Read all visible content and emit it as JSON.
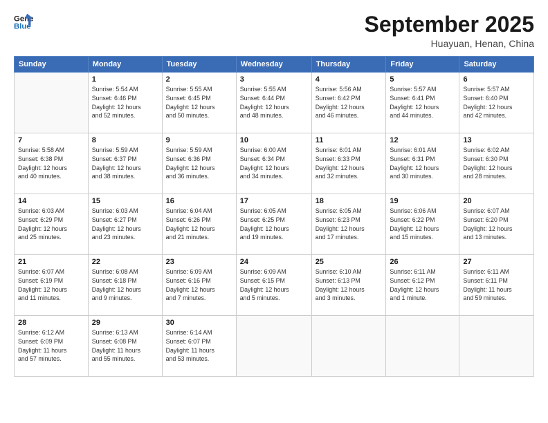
{
  "header": {
    "logo_line1": "General",
    "logo_line2": "Blue",
    "month": "September 2025",
    "location": "Huayuan, Henan, China"
  },
  "days_of_week": [
    "Sunday",
    "Monday",
    "Tuesday",
    "Wednesday",
    "Thursday",
    "Friday",
    "Saturday"
  ],
  "weeks": [
    [
      {
        "day": "",
        "info": ""
      },
      {
        "day": "1",
        "info": "Sunrise: 5:54 AM\nSunset: 6:46 PM\nDaylight: 12 hours\nand 52 minutes."
      },
      {
        "day": "2",
        "info": "Sunrise: 5:55 AM\nSunset: 6:45 PM\nDaylight: 12 hours\nand 50 minutes."
      },
      {
        "day": "3",
        "info": "Sunrise: 5:55 AM\nSunset: 6:44 PM\nDaylight: 12 hours\nand 48 minutes."
      },
      {
        "day": "4",
        "info": "Sunrise: 5:56 AM\nSunset: 6:42 PM\nDaylight: 12 hours\nand 46 minutes."
      },
      {
        "day": "5",
        "info": "Sunrise: 5:57 AM\nSunset: 6:41 PM\nDaylight: 12 hours\nand 44 minutes."
      },
      {
        "day": "6",
        "info": "Sunrise: 5:57 AM\nSunset: 6:40 PM\nDaylight: 12 hours\nand 42 minutes."
      }
    ],
    [
      {
        "day": "7",
        "info": "Sunrise: 5:58 AM\nSunset: 6:38 PM\nDaylight: 12 hours\nand 40 minutes."
      },
      {
        "day": "8",
        "info": "Sunrise: 5:59 AM\nSunset: 6:37 PM\nDaylight: 12 hours\nand 38 minutes."
      },
      {
        "day": "9",
        "info": "Sunrise: 5:59 AM\nSunset: 6:36 PM\nDaylight: 12 hours\nand 36 minutes."
      },
      {
        "day": "10",
        "info": "Sunrise: 6:00 AM\nSunset: 6:34 PM\nDaylight: 12 hours\nand 34 minutes."
      },
      {
        "day": "11",
        "info": "Sunrise: 6:01 AM\nSunset: 6:33 PM\nDaylight: 12 hours\nand 32 minutes."
      },
      {
        "day": "12",
        "info": "Sunrise: 6:01 AM\nSunset: 6:31 PM\nDaylight: 12 hours\nand 30 minutes."
      },
      {
        "day": "13",
        "info": "Sunrise: 6:02 AM\nSunset: 6:30 PM\nDaylight: 12 hours\nand 28 minutes."
      }
    ],
    [
      {
        "day": "14",
        "info": "Sunrise: 6:03 AM\nSunset: 6:29 PM\nDaylight: 12 hours\nand 25 minutes."
      },
      {
        "day": "15",
        "info": "Sunrise: 6:03 AM\nSunset: 6:27 PM\nDaylight: 12 hours\nand 23 minutes."
      },
      {
        "day": "16",
        "info": "Sunrise: 6:04 AM\nSunset: 6:26 PM\nDaylight: 12 hours\nand 21 minutes."
      },
      {
        "day": "17",
        "info": "Sunrise: 6:05 AM\nSunset: 6:25 PM\nDaylight: 12 hours\nand 19 minutes."
      },
      {
        "day": "18",
        "info": "Sunrise: 6:05 AM\nSunset: 6:23 PM\nDaylight: 12 hours\nand 17 minutes."
      },
      {
        "day": "19",
        "info": "Sunrise: 6:06 AM\nSunset: 6:22 PM\nDaylight: 12 hours\nand 15 minutes."
      },
      {
        "day": "20",
        "info": "Sunrise: 6:07 AM\nSunset: 6:20 PM\nDaylight: 12 hours\nand 13 minutes."
      }
    ],
    [
      {
        "day": "21",
        "info": "Sunrise: 6:07 AM\nSunset: 6:19 PM\nDaylight: 12 hours\nand 11 minutes."
      },
      {
        "day": "22",
        "info": "Sunrise: 6:08 AM\nSunset: 6:18 PM\nDaylight: 12 hours\nand 9 minutes."
      },
      {
        "day": "23",
        "info": "Sunrise: 6:09 AM\nSunset: 6:16 PM\nDaylight: 12 hours\nand 7 minutes."
      },
      {
        "day": "24",
        "info": "Sunrise: 6:09 AM\nSunset: 6:15 PM\nDaylight: 12 hours\nand 5 minutes."
      },
      {
        "day": "25",
        "info": "Sunrise: 6:10 AM\nSunset: 6:13 PM\nDaylight: 12 hours\nand 3 minutes."
      },
      {
        "day": "26",
        "info": "Sunrise: 6:11 AM\nSunset: 6:12 PM\nDaylight: 12 hours\nand 1 minute."
      },
      {
        "day": "27",
        "info": "Sunrise: 6:11 AM\nSunset: 6:11 PM\nDaylight: 11 hours\nand 59 minutes."
      }
    ],
    [
      {
        "day": "28",
        "info": "Sunrise: 6:12 AM\nSunset: 6:09 PM\nDaylight: 11 hours\nand 57 minutes."
      },
      {
        "day": "29",
        "info": "Sunrise: 6:13 AM\nSunset: 6:08 PM\nDaylight: 11 hours\nand 55 minutes."
      },
      {
        "day": "30",
        "info": "Sunrise: 6:14 AM\nSunset: 6:07 PM\nDaylight: 11 hours\nand 53 minutes."
      },
      {
        "day": "",
        "info": ""
      },
      {
        "day": "",
        "info": ""
      },
      {
        "day": "",
        "info": ""
      },
      {
        "day": "",
        "info": ""
      }
    ]
  ]
}
